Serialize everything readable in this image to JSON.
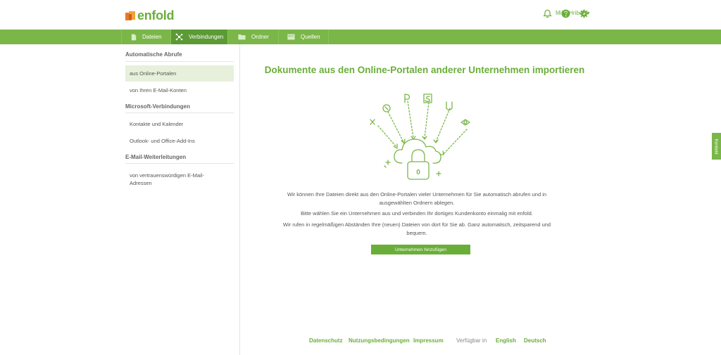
{
  "header": {
    "logo_text": "enfold",
    "user_name": "Mike Hribek ▾"
  },
  "nav": {
    "tabs": [
      {
        "label": "Dateien",
        "icon": "file-icon"
      },
      {
        "label": "Verbindungen",
        "icon": "network-icon",
        "active": true
      },
      {
        "label": "Ordner",
        "icon": "folder-icon"
      },
      {
        "label": "Quellen",
        "icon": "sources-icon"
      }
    ]
  },
  "sidebar": {
    "sections": [
      {
        "heading": "Automatische Abrufe",
        "items": [
          "aus Online-Portalen",
          "von Ihren E-Mail-Konten"
        ]
      },
      {
        "heading": "Microsoft-Verbindungen",
        "items": [
          "Kontakte und Kalender",
          "Outlook- und Office-Add-Ins"
        ]
      },
      {
        "heading": "E-Mail-Weiterleitungen",
        "items": [
          "von vertrauenswürdigen E-Mail-Adressen"
        ]
      }
    ]
  },
  "main": {
    "title": "Dokumente aus den Online-Portalen anderer Unternehmen importieren",
    "para1": "Wir können Ihre Dateien direkt aus den Online-Portalen vieler Unternehmen für Sie automatisch abrufen und in ausgewählten Ordnern ablegen.",
    "para2": "Bitte wählen Sie ein Unternehmen aus und verbinden Ihr dortiges Kundenkonto einmalig mit enfold.",
    "para3": "Wir rufen in regelmäßigen Abständen Ihre (neuen) Dateien von dort für Sie ab. Ganz automatisch, zeitsparend und bequem.",
    "button": "Unternehmen hinzufügen",
    "lock_digit": "0"
  },
  "footer": {
    "privacy": "Datenschutz",
    "terms": "Nutzungsbedingungen",
    "imprint": "Impressum",
    "available_in": "Verfügbar in",
    "lang_en": "English",
    "lang_de": "Deutsch"
  },
  "kontakt": "Kontakt",
  "colors": {
    "brand_green": "#6aae3a",
    "nav_green": "#7ab648",
    "nav_active": "#5c9a34"
  }
}
